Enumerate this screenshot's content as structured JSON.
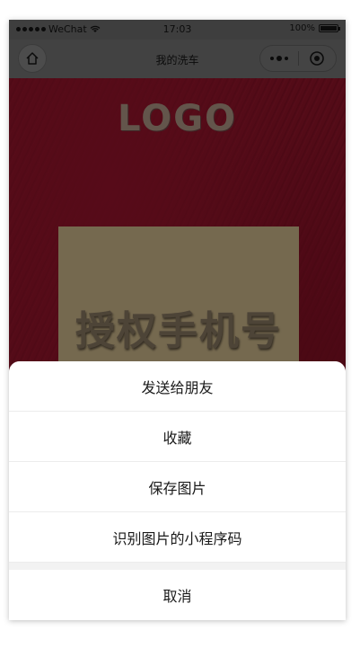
{
  "status_bar": {
    "carrier": "WeChat",
    "time": "17:03",
    "battery": "100%"
  },
  "navbar": {
    "title": "我的洗车"
  },
  "content": {
    "logo_text": "LOGO",
    "auth_text": "授权手机号"
  },
  "action_sheet": {
    "items": [
      "发送给朋友",
      "收藏",
      "保存图片",
      "识别图片的小程序码"
    ],
    "cancel": "取消"
  },
  "icons": {
    "home": "home-icon",
    "more": "more-dots-icon",
    "close": "capsule-close-icon",
    "wifi": "wifi-icon",
    "battery": "battery-icon"
  }
}
